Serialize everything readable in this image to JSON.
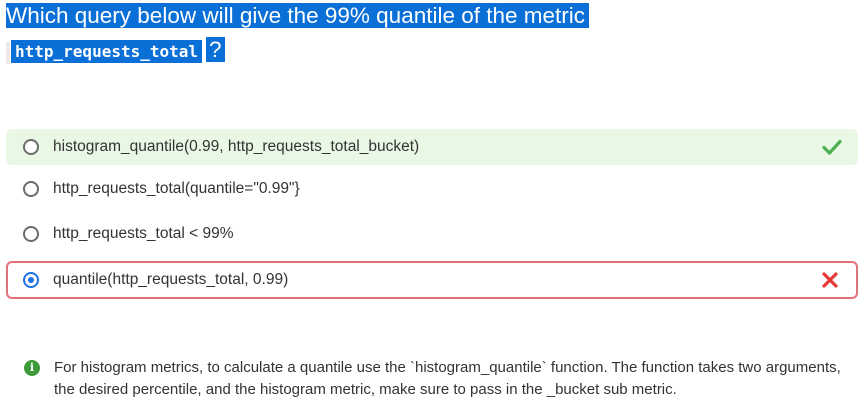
{
  "question": {
    "line1": "Which query below will give the 99% quantile of the metric",
    "code": "http_requests_total",
    "qmark": "?"
  },
  "options": [
    {
      "label": "histogram_quantile(0.99, http_requests_total_bucket)",
      "selected": false,
      "status": "correct"
    },
    {
      "label": "http_requests_total(quantile=\"0.99\"}",
      "selected": false,
      "status": "none"
    },
    {
      "label": "http_requests_total < 99%",
      "selected": false,
      "status": "none"
    },
    {
      "label": "quantile(http_requests_total, 0.99)",
      "selected": true,
      "status": "incorrect"
    }
  ],
  "icons": {
    "correct": "checkmark-icon",
    "incorrect": "cross-icon",
    "info": "info-icon"
  },
  "colors": {
    "selection": "#0a6fd6",
    "correct_bg": "#e8f8e4",
    "correct_mark": "#4caf50",
    "incorrect_border": "#e0707a",
    "incorrect_mark": "#e53935",
    "radio_selected": "#1a73e8",
    "info": "#3f9b3a"
  },
  "explanation": {
    "icon_glyph": "i",
    "text": "For histogram metrics, to calculate a quantile use the `histogram_quantile` function. The function takes two arguments, the desired percentile, and the histogram metric, make sure to pass in the _bucket sub metric."
  }
}
